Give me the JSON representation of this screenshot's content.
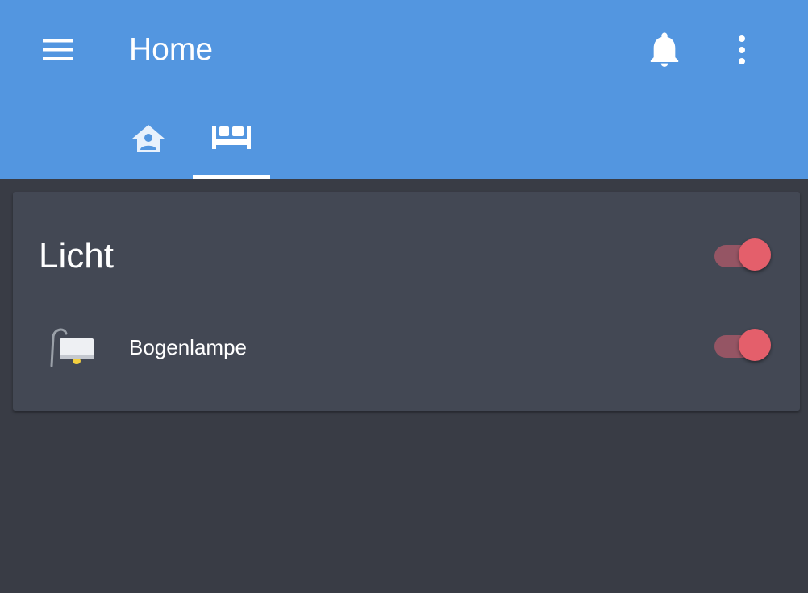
{
  "header": {
    "title": "Home",
    "menu_icon": "menu-icon",
    "notifications_icon": "bell-icon",
    "more_icon": "more-vert-icon",
    "background_color": "#5396e0"
  },
  "tabs": [
    {
      "icon": "home-account-icon",
      "selected": false
    },
    {
      "icon": "bed-icon",
      "selected": true
    }
  ],
  "card": {
    "title": "Licht",
    "group_toggle": {
      "state": "on"
    },
    "entities": [
      {
        "name": "Bogenlampe",
        "icon": "floor-lamp-icon",
        "state": "on"
      }
    ]
  },
  "colors": {
    "background": "#393c45",
    "card": "#434854",
    "toggle_on": "#e45f6b"
  }
}
